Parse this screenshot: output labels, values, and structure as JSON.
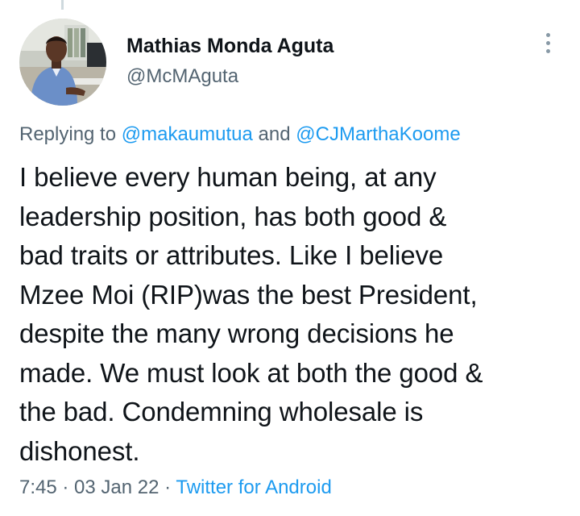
{
  "author": {
    "display_name": "Mathias Monda Aguta",
    "handle": "@McMAguta"
  },
  "replying": {
    "prefix": "Replying to ",
    "mention_1": "@makaumutua",
    "separator": " and ",
    "mention_2": "@CJMarthaKoome"
  },
  "tweet": {
    "text": "I believe every human being, at any\nleadership position, has both good &\nbad traits or attributes. Like I believe\nMzee Moi (RIP)was the best President,\ndespite the many wrong decisions he\nmade. We must look at both the good &\nthe bad. Condemning wholesale is\ndishonest."
  },
  "meta": {
    "time": "7:45",
    "dot_1": " · ",
    "date": "03 Jan 22",
    "dot_2": " · ",
    "source": "Twitter for Android"
  },
  "icons": {
    "more": "more-vertical-icon"
  },
  "colors": {
    "link": "#1d9bf0",
    "secondary_text": "#536471",
    "primary_text": "#0f1419"
  }
}
